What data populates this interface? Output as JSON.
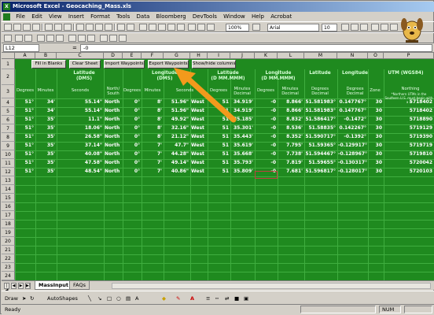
{
  "window": {
    "title": "Microsoft Excel - Geocaching_Mass.xls"
  },
  "menu": [
    "File",
    "Edit",
    "View",
    "Insert",
    "Format",
    "Tools",
    "Data",
    "Bloomberg",
    "DevTools",
    "Window",
    "Help",
    "Acrobat"
  ],
  "toolbar": {
    "zoom": "100%",
    "font": "Arial",
    "size": "10"
  },
  "formula": {
    "name_box": "L12",
    "eq": "=",
    "value": "-0"
  },
  "columns": [
    "A",
    "B",
    "C",
    "D",
    "E",
    "F",
    "G",
    "H",
    "I",
    "J",
    "K",
    "L",
    "M",
    "N",
    "O",
    "P"
  ],
  "rows": [
    "1",
    "2",
    "3",
    "4",
    "5",
    "6",
    "7",
    "8",
    "9",
    "10",
    "11",
    "12",
    "13",
    "14",
    "15",
    "16",
    "17",
    "18",
    "19",
    "20",
    "21",
    "22",
    "23",
    "24",
    "25",
    "26",
    "27"
  ],
  "buttons": [
    "Fill in Blanks",
    "Clear Sheet",
    "Import Waypoints",
    "Export Waypoints",
    "Show/hide columns"
  ],
  "groups": [
    {
      "label": "Latitude",
      "sub": "(DMS)"
    },
    {
      "label": "Longitude",
      "sub": "(DMS)"
    },
    {
      "label": "Latitude",
      "sub": "(D MM.MMM)"
    },
    {
      "label": "Longitude",
      "sub": "(D MM.MMM)"
    },
    {
      "label": "Latitude",
      "sub": ""
    },
    {
      "label": "Longitude",
      "sub": ""
    },
    {
      "label": "UTM (WGS84)",
      "sub": ""
    }
  ],
  "subheaders": {
    "deg1": "Degrees",
    "min1": "Minutes",
    "sec1": "Seconds",
    "ns": "North/ South",
    "deg2": "Degrees",
    "min2": "Minutes",
    "sec2": "Seconds",
    "deg3": "Degrees",
    "min3": "Minutes Decimal",
    "deg4": "Degrees",
    "min4": "Minutes Decimal",
    "degdec1": "Degrees Decimal",
    "degdec2": "Degrees Decimal",
    "zone": "Zone",
    "northing": "Northing",
    "note": "*Northern UTMs in the Southern U.S. must begin with a 4"
  },
  "data_rows": [
    {
      "a": "51°",
      "b": "34'",
      "c": "55.14\"",
      "d": "North",
      "e": "0°",
      "f": "8'",
      "g": "51.96\"",
      "h": "West",
      "i": "51",
      "j": "34.919'",
      "k": "-0",
      "l": "8.866'",
      "m": "51.581983°",
      "n": "0.147767°",
      "o": "30",
      "p": "5718402"
    },
    {
      "a": "51°",
      "b": "34'",
      "c": "55.14\"",
      "d": "North",
      "e": "0°",
      "f": "8'",
      "g": "51.96\"",
      "h": "West",
      "i": "51",
      "j": "34.919'",
      "k": "-0",
      "l": "8.866'",
      "m": "51.581983°",
      "n": "0.147767°",
      "o": "30",
      "p": "5718402"
    },
    {
      "a": "51°",
      "b": "35'",
      "c": "11.1\"",
      "d": "North",
      "e": "0°",
      "f": "8'",
      "g": "49.92\"",
      "h": "West",
      "i": "51",
      "j": "35.185'",
      "k": "-0",
      "l": "8.832'",
      "m": "51.586417°",
      "n": "-0.1472°",
      "o": "30",
      "p": "5718890"
    },
    {
      "a": "51°",
      "b": "35'",
      "c": "18.06\"",
      "d": "North",
      "e": "0°",
      "f": "8'",
      "g": "32.16\"",
      "h": "West",
      "i": "51",
      "j": "35.301'",
      "k": "-0",
      "l": "8.536'",
      "m": "51.58835°",
      "n": "0.142267°",
      "o": "30",
      "p": "5719129"
    },
    {
      "a": "51°",
      "b": "35'",
      "c": "26.58\"",
      "d": "North",
      "e": "0°",
      "f": "8'",
      "g": "21.12\"",
      "h": "West",
      "i": "51",
      "j": "35.443'",
      "k": "-0",
      "l": "8.352'",
      "m": "51.590717°",
      "n": "-0.1392°",
      "o": "30",
      "p": "5719390"
    },
    {
      "a": "51°",
      "b": "35'",
      "c": "37.14\"",
      "d": "North",
      "e": "0°",
      "f": "7'",
      "g": "47.7\"",
      "h": "West",
      "i": "51",
      "j": "35.619'",
      "k": "-0",
      "l": "7.795'",
      "m": "51.59365°",
      "n": "-0.129917°",
      "o": "30",
      "p": "5719719"
    },
    {
      "a": "51°",
      "b": "35'",
      "c": "40.08\"",
      "d": "North",
      "e": "0°",
      "f": "7'",
      "g": "44.28\"",
      "h": "West",
      "i": "51",
      "j": "35.668'",
      "k": "-0",
      "l": "7.738'",
      "m": "51.594467°",
      "n": "-0.128967°",
      "o": "30",
      "p": "5719810"
    },
    {
      "a": "51°",
      "b": "35'",
      "c": "47.58\"",
      "d": "North",
      "e": "0°",
      "f": "7'",
      "g": "49.14\"",
      "h": "West",
      "i": "51",
      "j": "35.793'",
      "k": "-0",
      "l": "7.819'",
      "m": "51.59655°",
      "n": "-0.130317°",
      "o": "30",
      "p": "5720042"
    },
    {
      "a": "51°",
      "b": "35'",
      "c": "48.54\"",
      "d": "North",
      "e": "0°",
      "f": "7'",
      "g": "40.86\"",
      "h": "West",
      "i": "51",
      "j": "35.809'",
      "k": "-0",
      "l": "7.681'",
      "m": "51.596817°",
      "n": "-0.128017°",
      "o": "30",
      "p": "5720103"
    }
  ],
  "sheet_tabs": [
    "MassInput",
    "FAQs"
  ],
  "drawbar": {
    "draw": "Draw",
    "autoshapes": "AutoShapes"
  },
  "status": {
    "ready": "Ready",
    "num": "NUM"
  },
  "colors": {
    "grid_green": "#1f8a1f",
    "arrow_orange": "#f39a1c",
    "title_blue": "#0a246a"
  },
  "icons": [
    "excel-icon",
    "new-icon",
    "open-icon",
    "save-icon",
    "print-icon",
    "cut-icon",
    "copy-icon",
    "paste-icon",
    "undo-icon",
    "chart-icon",
    "dog-mascot-icon",
    "arrow-pointer-icon"
  ]
}
